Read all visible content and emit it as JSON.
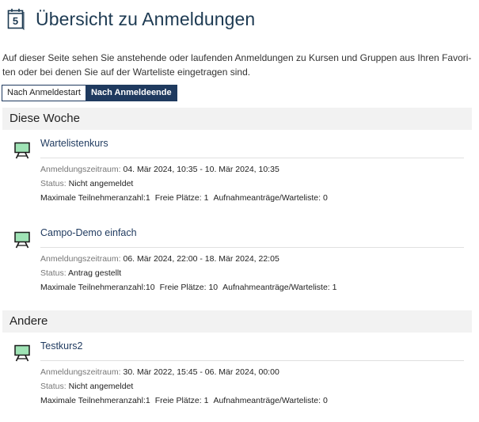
{
  "page": {
    "icon_label": "5",
    "title": "Übersicht zu Anmeldungen",
    "intro_line1": "Auf dieser Seite sehen Sie anstehende oder laufenden Anmeldungen zu Kursen und Gruppen aus Ihren Favori-",
    "intro_line2": "ten oder bei denen Sie auf der Warteliste eingetragen sind."
  },
  "sort": {
    "start_label": "Nach Anmeldestart",
    "end_label": "Nach Anmeldeende",
    "active": "end"
  },
  "labels": {
    "period": "Anmeldungszeitraum:",
    "status": "Status:",
    "max": "Maximale Teilnehmeranzahl:",
    "free": "Freie Plätze:",
    "waitlist": "Aufnahmeanträge/Warteliste:"
  },
  "sections": [
    {
      "title": "Diese Woche",
      "courses": [
        {
          "title": "Wartelistenkurs",
          "period": "04. Mär 2024, 10:35 - 10. Mär 2024, 10:35",
          "status": "Nicht angemeldet",
          "max": "1",
          "free": "1",
          "waitlist": "0"
        },
        {
          "title": "Campo-Demo einfach",
          "period": "06. Mär 2024, 22:00 - 18. Mär 2024, 22:05",
          "status": "Antrag gestellt",
          "max": "10",
          "free": "10",
          "waitlist": "1"
        }
      ]
    },
    {
      "title": "Andere",
      "courses": [
        {
          "title": "Testkurs2",
          "period": "30. Mär 2022, 15:45 - 06. Mär 2024, 00:00",
          "status": "Nicht angemeldet",
          "max": "1",
          "free": "1",
          "waitlist": "0"
        }
      ]
    }
  ],
  "colors": {
    "title": "#1d3a52",
    "active_button": "#1f3a5f",
    "section_bg": "#f2f2f2",
    "course_icon_board": "#9fe3b5"
  },
  "icons": {
    "header": "calendar-icon",
    "course": "easel-board-icon"
  }
}
